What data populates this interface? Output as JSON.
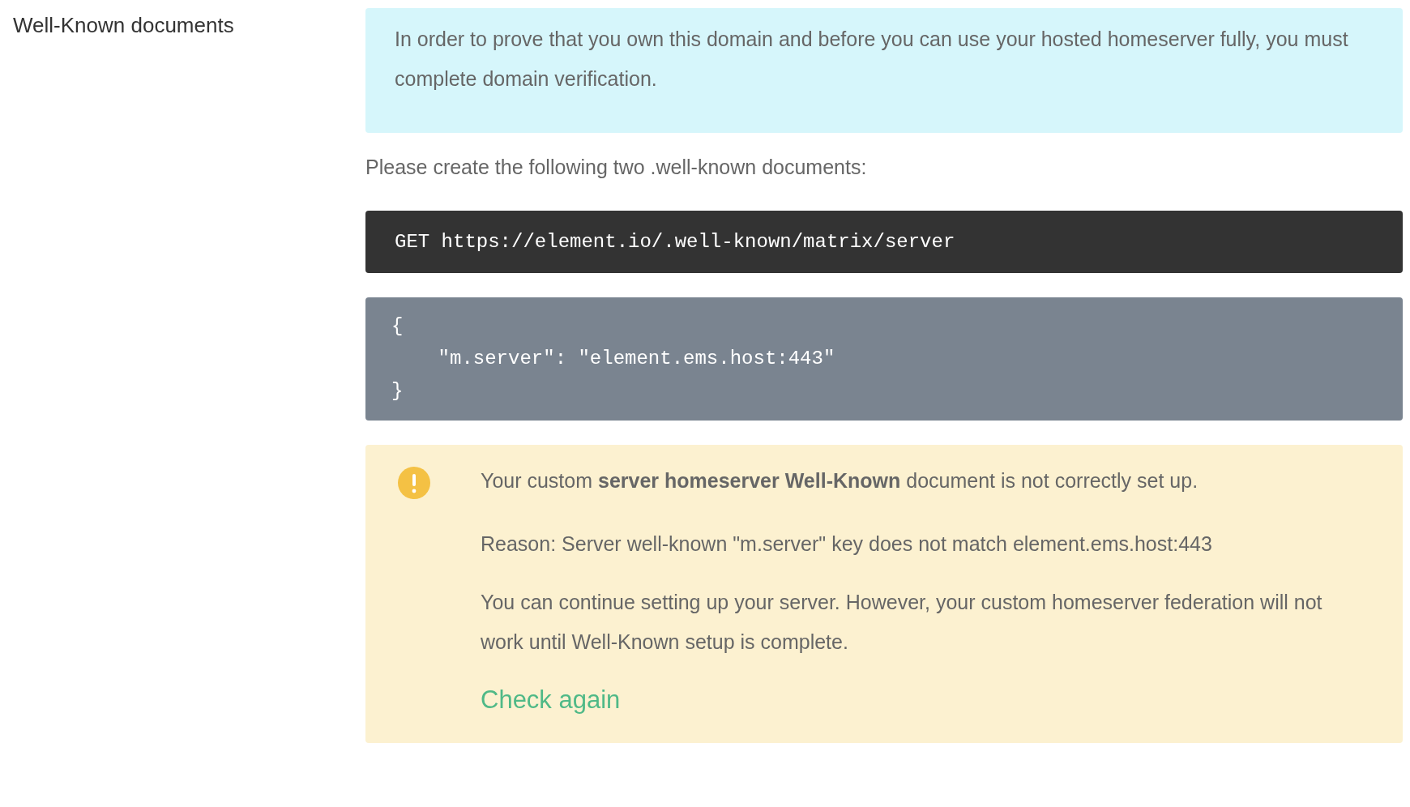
{
  "section_label": "Well-Known documents",
  "info_notice": "In order to prove that you own this domain and before you can use your hosted homeserver fully, you must complete domain verification.",
  "instruction": "Please create the following two .well-known documents:",
  "request_line": "GET https://element.io/.well-known/matrix/server",
  "response_lines": [
    "{",
    "    \"m.server\": \"element.ems.host:443\"",
    "}"
  ],
  "warning": {
    "message": "Your custom **server homeserver Well-Known** document is not correctly set up.",
    "reason": "Reason: Server well-known \"m.server\" key does not match element.ems.host:443",
    "note": "You can continue setting up your server. However, your custom homeserver federation will not work until Well-Known setup is complete.",
    "link": "Check again"
  }
}
